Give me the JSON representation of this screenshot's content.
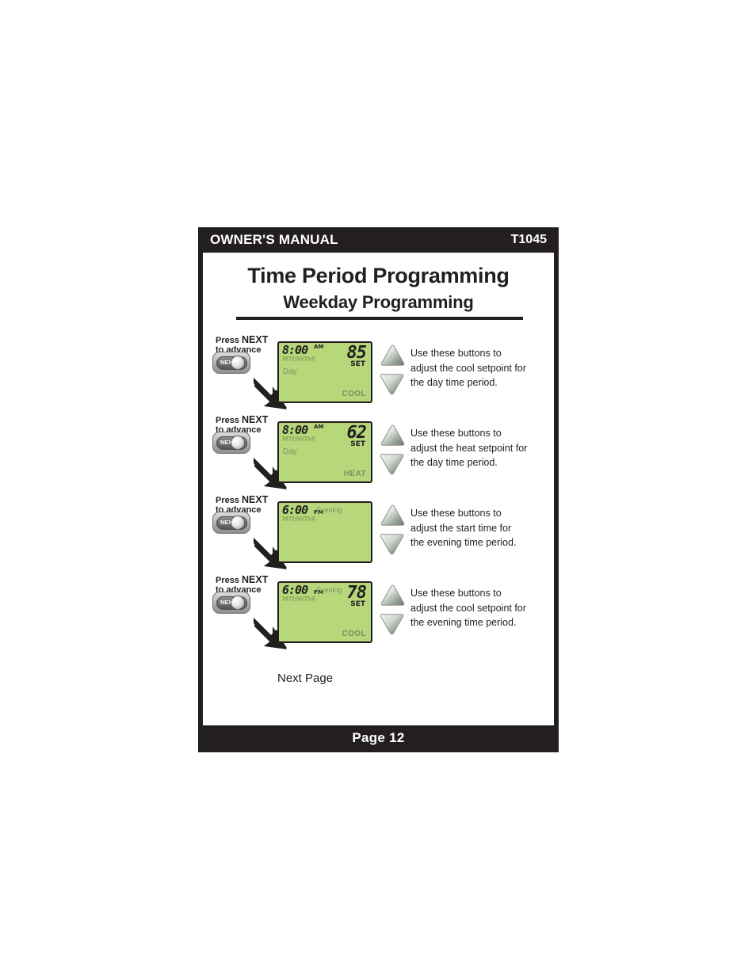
{
  "header": {
    "title": "OWNER'S MANUAL",
    "model": "T1045"
  },
  "titles": {
    "main": "Time Period Programming",
    "sub": "Weekday Programming"
  },
  "footer": {
    "page_label": "Page 12"
  },
  "common": {
    "press_line1_prefix": "Press ",
    "press_line1_keyword": "NEXT",
    "press_line2": "to advance",
    "next_button_label": "NEXT",
    "instruction_line1": "Use these buttons to"
  },
  "next_page_caption": "Next Page",
  "colors": {
    "lcd_green": "#b6d77a",
    "frame_black": "#231f20",
    "lcd_dim_text": "#7a8f62",
    "button_grey": "#b6b6b6"
  },
  "steps": [
    {
      "press_line1_prefix": "Press ",
      "press_line1_keyword": "NEXT",
      "press_line2": "to advance",
      "next_button_label": "NEXT",
      "lcd": {
        "time": "8:00",
        "ampm": "AM",
        "ampm_position": "am",
        "days": "MTUWThF",
        "period_left": "Day",
        "period_top": "",
        "setpoint": "85",
        "set_label": "SET",
        "mode": "COOL"
      },
      "instruction": {
        "line1": "Use these buttons to",
        "line2": "adjust the cool setpoint for",
        "line3": "the day time period."
      }
    },
    {
      "press_line1_prefix": "Press ",
      "press_line1_keyword": "NEXT",
      "press_line2": "to advance",
      "next_button_label": "NEXT",
      "lcd": {
        "time": "8:00",
        "ampm": "AM",
        "ampm_position": "am",
        "days": "MTUWThF",
        "period_left": "Day",
        "period_top": "",
        "setpoint": "62",
        "set_label": "SET",
        "mode": "HEAT"
      },
      "instruction": {
        "line1": "Use these buttons to",
        "line2": "adjust the heat setpoint for",
        "line3": "the day time period."
      }
    },
    {
      "press_line1_prefix": "Press ",
      "press_line1_keyword": "NEXT",
      "press_line2": "to advance",
      "next_button_label": "NEXT",
      "lcd": {
        "time": "6:00",
        "ampm": "PM",
        "ampm_position": "pm",
        "days": "MTUWThF",
        "period_left": "",
        "period_top": "Evening",
        "setpoint": "",
        "set_label": "",
        "mode": ""
      },
      "instruction": {
        "line1": "Use these buttons to",
        "line2": "adjust the start time for",
        "line3": "the evening time period."
      }
    },
    {
      "press_line1_prefix": "Press ",
      "press_line1_keyword": "NEXT",
      "press_line2": "to advance",
      "next_button_label": "NEXT",
      "lcd": {
        "time": "6:00",
        "ampm": "PM",
        "ampm_position": "pm",
        "days": "MTUWThF",
        "period_left": "",
        "period_top": "Evening",
        "setpoint": "78",
        "set_label": "SET",
        "mode": "COOL"
      },
      "instruction": {
        "line1": "Use these buttons to",
        "line2": "adjust the cool setpoint for",
        "line3": "the evening time period."
      }
    }
  ]
}
